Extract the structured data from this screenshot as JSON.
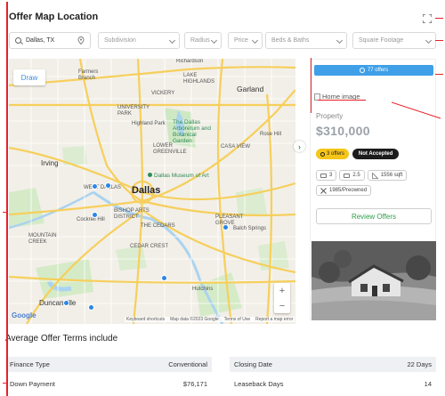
{
  "page": {
    "title": "Offer Map Location"
  },
  "filters": {
    "location_value": "Dallas, TX",
    "subdivision_placeholder": "Subdivision",
    "radius_label": "Radius",
    "price_label": "Price",
    "beds_baths_label": "Beds & Baths",
    "square_footage_label": "Square Footage"
  },
  "map": {
    "draw_label": "Draw",
    "labels": {
      "richardson": "Richardson",
      "farmers_branch": "Farmers\nBranch",
      "garland": "Garland",
      "dallas_arboretum": "The Dallas\nArboretum and\nBotanical\nGarden",
      "irving": "Irving",
      "dallas": "Dallas",
      "dallas_museum": "Dallas Museum of Art",
      "highland_park": "Highland Park",
      "rose_hill": "Rose Hill",
      "cockrell_hill": "Cockrell Hill",
      "balch_springs": "Balch Springs",
      "hutchins": "Hutchins",
      "duncanville": "Duncanville",
      "vickery": "VICKERY",
      "casa_view": "CASA VIEW",
      "lake_highlands": "LAKE\nHIGHLANDS",
      "lower_greenville": "LOWER\nGREENVILLE",
      "west_dallas": "WEST DALLAS",
      "bishop_arts": "BISHOP ARTS\nDISTRICT",
      "pleasant_grove": "PLEASANT\nGROVE",
      "cedar_crest": "CEDAR CREST",
      "mountain_creek": "MOUNTAIN\nCREEK",
      "the_cedars": "THE CEDARS",
      "university_park": "UNIVERSITY\nPARK"
    },
    "zoom_in": "+",
    "zoom_out": "−",
    "google": "Google",
    "attrib": {
      "shortcuts": "Keyboard shortcuts",
      "mapdata": "Map data ©2023 Google",
      "terms": "Terms of Use",
      "report": "Report a map error"
    }
  },
  "card": {
    "offers_count": "77 offers",
    "image_alt": "Home image",
    "property_label": "Property",
    "price": "$310,000",
    "offers_badge": "3 offers",
    "status_badge": "Not Accepted",
    "beds": "3",
    "baths": "2.5",
    "sqft": "1556 sqft",
    "year_built": "1985/Preowned",
    "review_button": "Review Offers"
  },
  "terms": {
    "section_title": "Average Offer Terms include",
    "left": [
      {
        "label": "Finance Type",
        "value": "Conventional"
      },
      {
        "label": "Down Payment",
        "value": "$76,171"
      }
    ],
    "right": [
      {
        "label": "Closing Date",
        "value": "22 Days"
      },
      {
        "label": "Leaseback Days",
        "value": "14"
      }
    ]
  },
  "colors": {
    "accent_blue": "#3fa0e8",
    "review_green": "#2e9e4a",
    "marker_blue": "#2b86e8",
    "annotation_red": "#e8202a"
  }
}
